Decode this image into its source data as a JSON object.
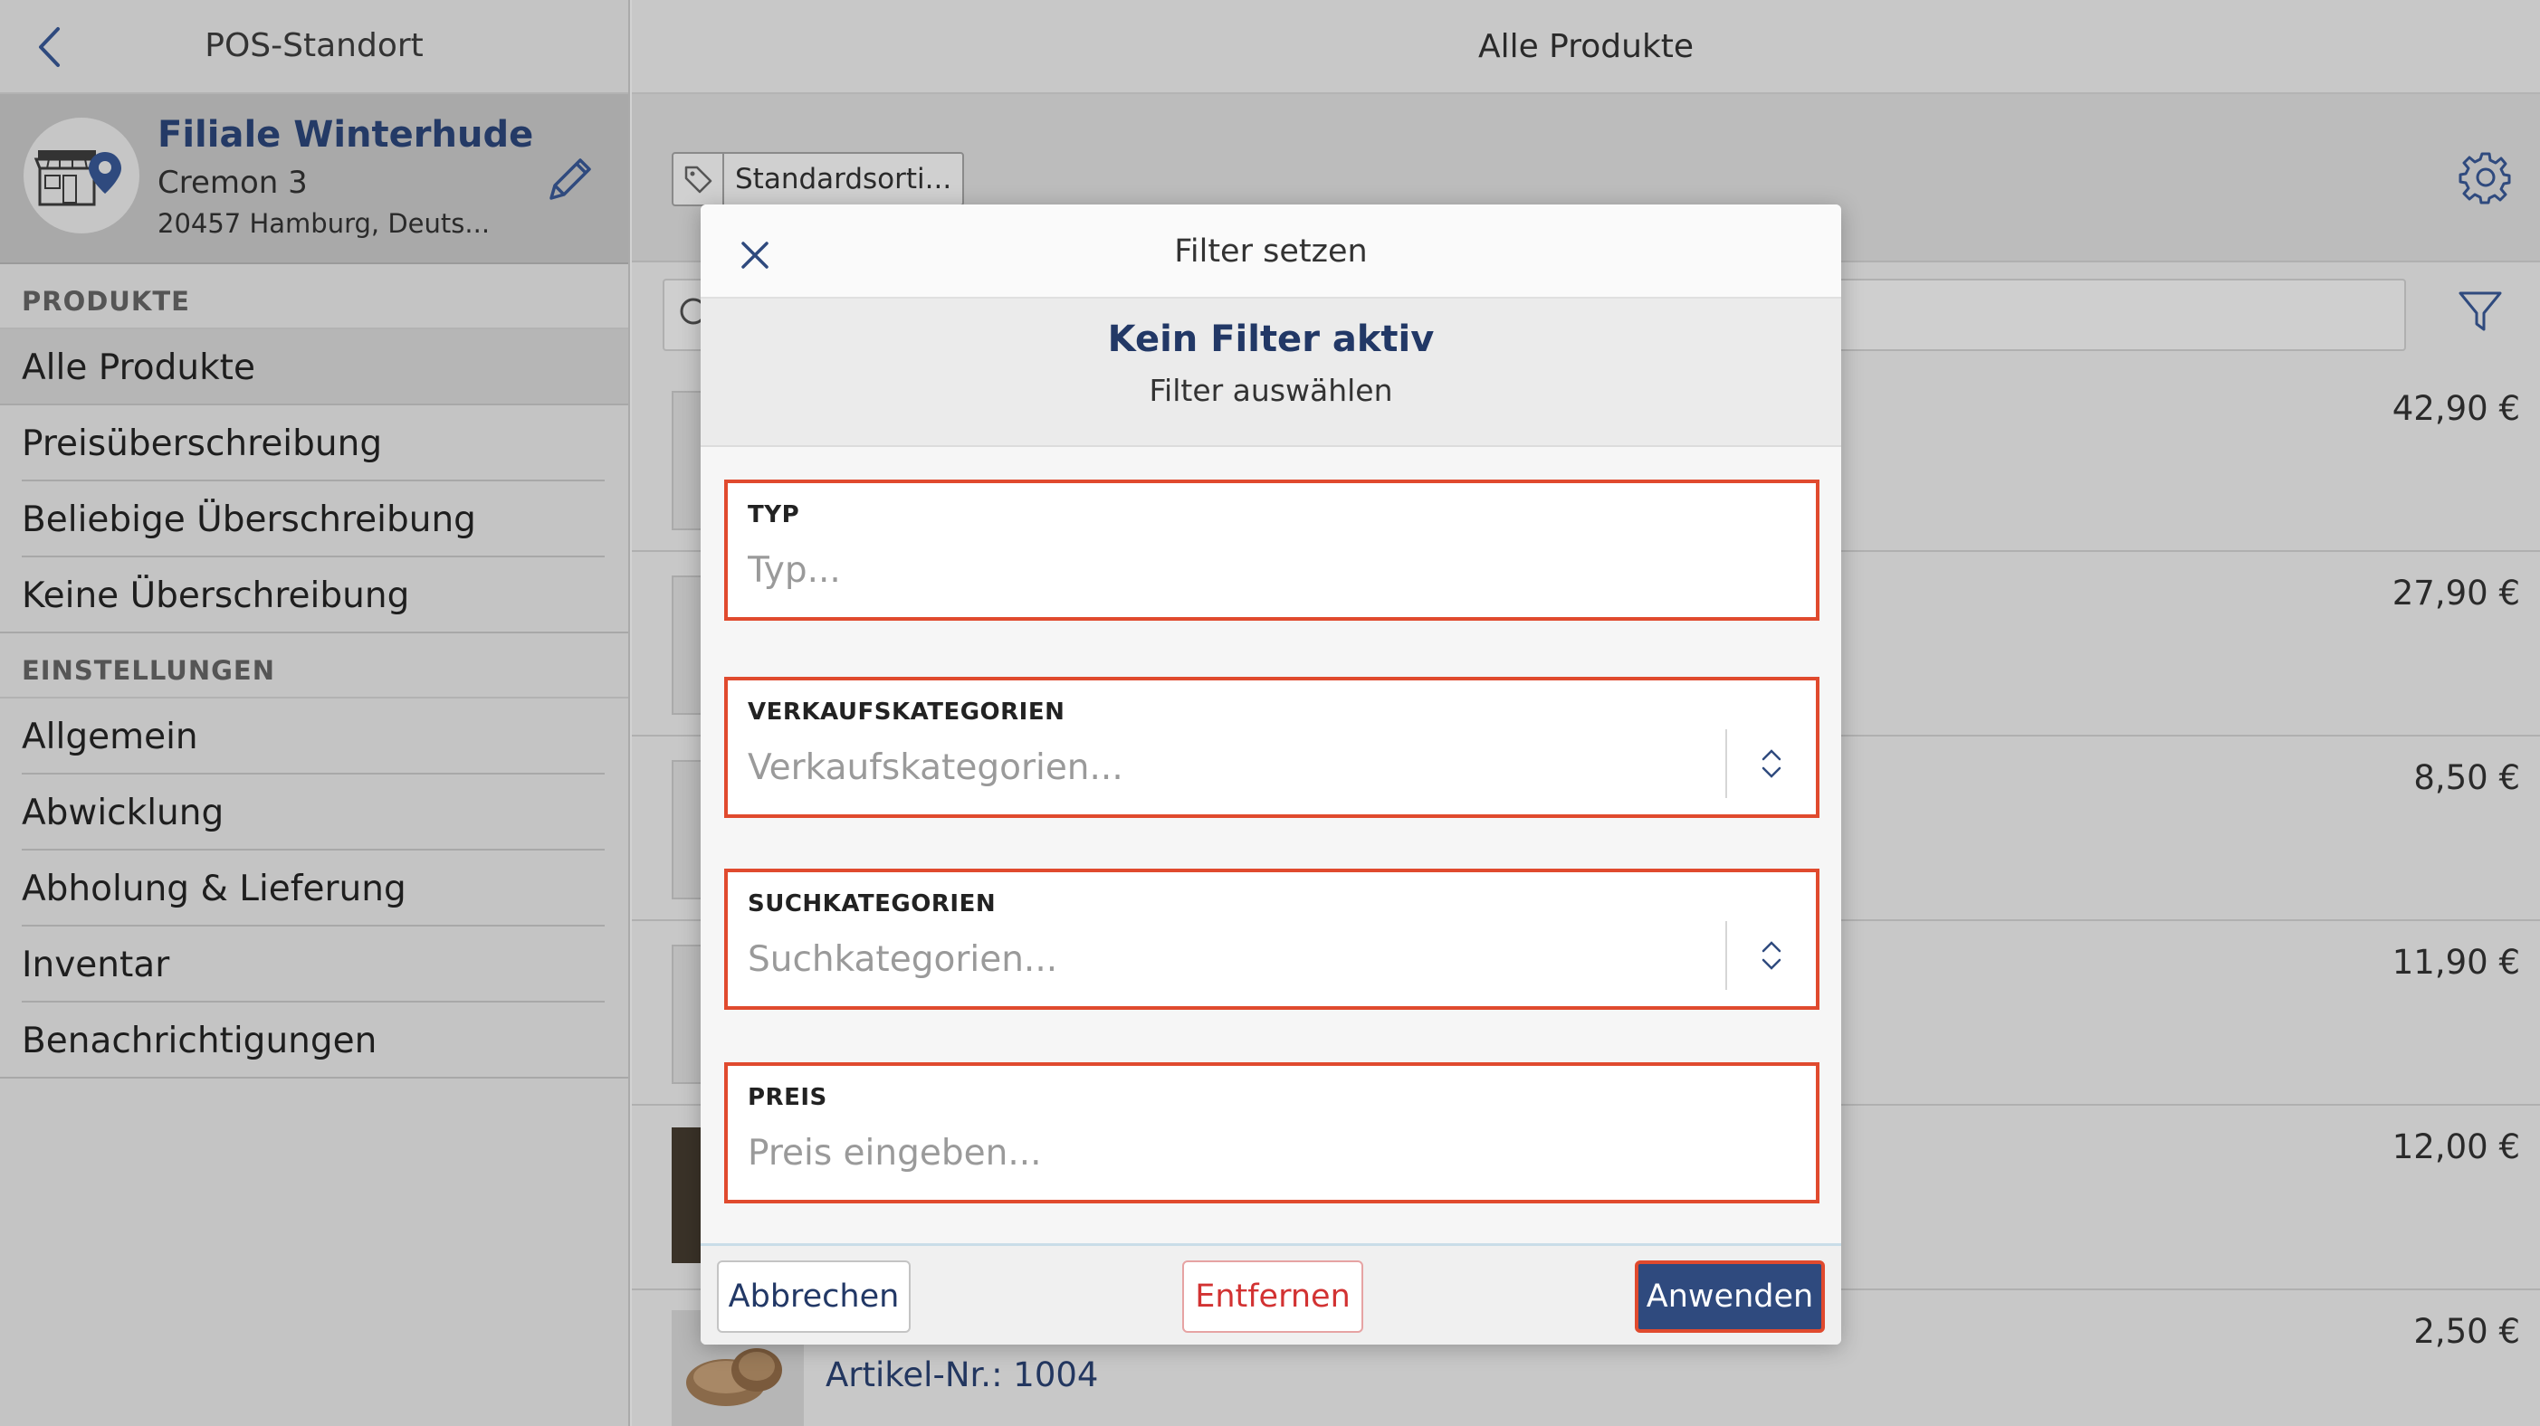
{
  "sidebar": {
    "title": "POS-Standort",
    "location": {
      "name": "Filiale Winterhude",
      "street": "Cremon 3",
      "city": "20457 Hamburg, Deuts..."
    },
    "section_products": "PRODUKTE",
    "products": [
      {
        "label": "Alle Produkte",
        "active": true
      },
      {
        "label": "Preisüberschreibung"
      },
      {
        "label": "Beliebige Überschreibung"
      },
      {
        "label": "Keine Überschreibung"
      }
    ],
    "section_settings": "EINSTELLUNGEN",
    "settings": [
      {
        "label": "Allgemein"
      },
      {
        "label": "Abwicklung"
      },
      {
        "label": "Abholung & Lieferung"
      },
      {
        "label": "Inventar"
      },
      {
        "label": "Benachrichtigungen"
      }
    ]
  },
  "main": {
    "title": "Alle Produkte",
    "tag_chip": "Standardsorti...",
    "prices": [
      "42,90 €",
      "27,90 €",
      "8,50 €",
      "11,90 €",
      "12,00 €",
      "2,50 €"
    ],
    "last_row_article": "Artikel-Nr.: 1004"
  },
  "modal": {
    "title": "Filter setzen",
    "status_title": "Kein Filter aktiv",
    "status_subtitle": "Filter auswählen",
    "fields": {
      "type": {
        "label": "TYP",
        "placeholder": "Typ...",
        "value": ""
      },
      "sales_categories": {
        "label": "VERKAUFSKATEGORIEN",
        "placeholder": "Verkaufskategorien...",
        "value": ""
      },
      "search_categories": {
        "label": "SUCHKATEGORIEN",
        "placeholder": "Suchkategorien...",
        "value": ""
      },
      "price": {
        "label": "PREIS",
        "placeholder": "Preis eingeben...",
        "value": ""
      }
    },
    "buttons": {
      "cancel": "Abbrechen",
      "remove": "Entfernen",
      "apply": "Anwenden"
    }
  },
  "colors": {
    "accent_navy": "#2f4a7e",
    "highlight_red": "#e04a2e",
    "remove_red": "#d23232"
  }
}
